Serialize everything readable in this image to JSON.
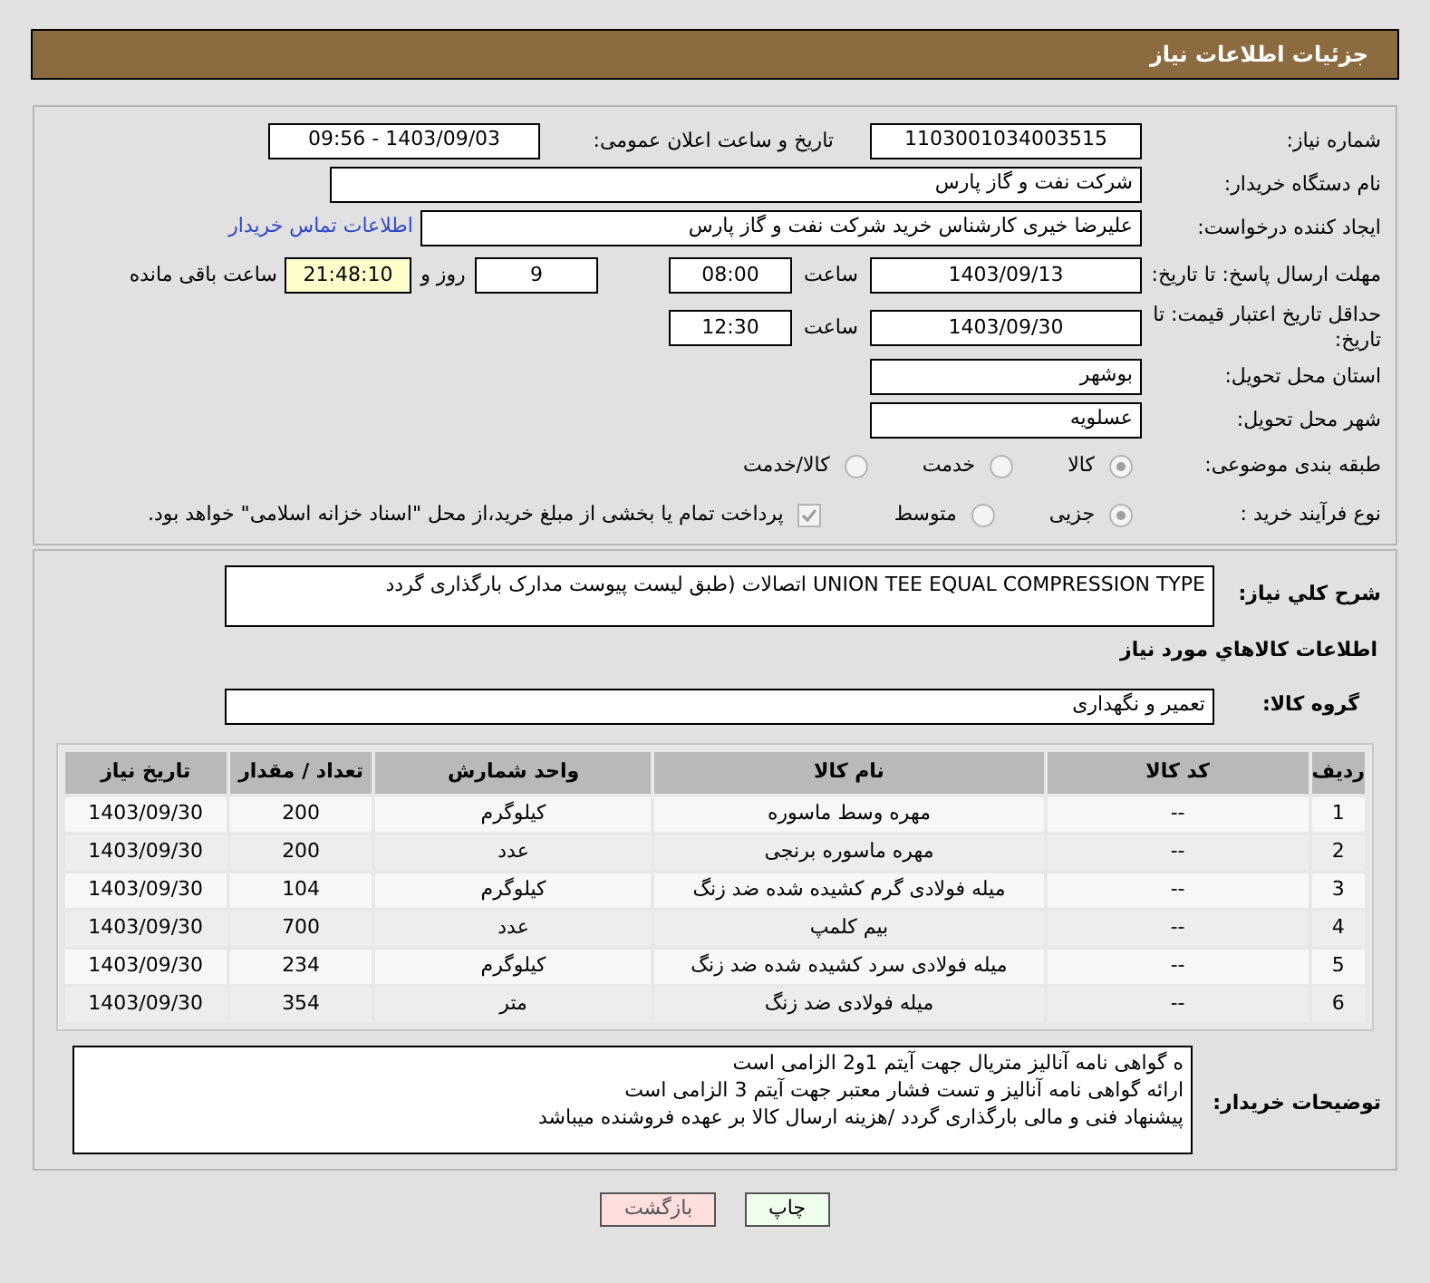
{
  "header": {
    "title": "جزئیات اطلاعات نیاز"
  },
  "need_number": {
    "label": "شماره نیاز:",
    "value": "1103001034003515"
  },
  "announce": {
    "label": "تاریخ و ساعت اعلان عمومی:",
    "value": "1403/09/03 - 09:56"
  },
  "buyer": {
    "label": "نام دستگاه خریدار:",
    "value": "شرکت نفت و گاز پارس"
  },
  "creator": {
    "label": "ایجاد کننده درخواست:",
    "value": "علیرضا  خیری کارشناس خرید  شرکت نفت و گاز پارس",
    "link": "اطلاعات تماس خریدار"
  },
  "deadline": {
    "label": "مهلت ارسال پاسخ: تا تاریخ:",
    "date": "1403/09/13",
    "time_label": "ساعت",
    "time": "08:00",
    "days": "9",
    "days_label": "روز و",
    "remaining": "21:48:10",
    "remaining_label": "ساعت باقی مانده"
  },
  "validity": {
    "label": "حداقل تاریخ اعتبار قیمت: تا تاریخ:",
    "date": "1403/09/30",
    "time_label": "ساعت",
    "time": "12:30"
  },
  "province": {
    "label": "استان محل تحویل:",
    "value": "بوشهر"
  },
  "city": {
    "label": "شهر محل تحویل:",
    "value": "عسلویه"
  },
  "category": {
    "label": "طبقه بندی موضوعی:",
    "options": [
      {
        "label": "کالا",
        "selected": true
      },
      {
        "label": "خدمت",
        "selected": false
      },
      {
        "label": "کالا/خدمت",
        "selected": false
      }
    ]
  },
  "process": {
    "label": "نوع فرآیند خرید :",
    "options": [
      {
        "label": "جزیی",
        "selected": true
      },
      {
        "label": "متوسط",
        "selected": false
      }
    ],
    "treasury": {
      "label": "پرداخت تمام یا بخشی از مبلغ خرید،از محل \"اسناد خزانه اسلامی\" خواهد بود.",
      "checked": true
    }
  },
  "description": {
    "label": "شرح کلي نياز:",
    "value": "UNION TEE EQUAL COMPRESSION TYPE اتصالات (طبق لیست پیوست مدارک بارگذاری گردد"
  },
  "items_heading": "اطلاعات کالاهاي مورد نياز",
  "goods_group": {
    "label": "گروه کالا:",
    "value": "تعمیر و نگهداری"
  },
  "table": {
    "columns": [
      "ردیف",
      "کد کالا",
      "نام کالا",
      "واحد شمارش",
      "تعداد / مقدار",
      "تاریخ نیاز"
    ],
    "rows": [
      [
        "1",
        "--",
        "مهره وسط ماسوره",
        "کیلوگرم",
        "200",
        "1403/09/30"
      ],
      [
        "2",
        "--",
        "مهره ماسوره برنجی",
        "عدد",
        "200",
        "1403/09/30"
      ],
      [
        "3",
        "--",
        "میله فولادی گرم کشیده شده ضد زنگ",
        "کیلوگرم",
        "104",
        "1403/09/30"
      ],
      [
        "4",
        "--",
        "بیم کلمپ",
        "عدد",
        "700",
        "1403/09/30"
      ],
      [
        "5",
        "--",
        "میله فولادی سرد کشیده شده ضد زنگ",
        "کیلوگرم",
        "234",
        "1403/09/30"
      ],
      [
        "6",
        "--",
        "میله فولادی ضد زنگ",
        "متر",
        "354",
        "1403/09/30"
      ]
    ]
  },
  "notes": {
    "label": "توضیحات خریدار:",
    "lines": [
      "ه گواهی نامه آنالیز متریال جهت آیتم 1و2 الزامی است",
      "ارائه گواهی نامه آنالیز و تست فشار معتبر جهت آیتم 3 الزامی است",
      "پیشنهاد فنی و مالی بارگذاری گردد /هزینه ارسال کالا بر عهده فروشنده میباشد"
    ]
  },
  "buttons": [
    {
      "label": "چاپ",
      "kind": "print"
    },
    {
      "label": "بازگشت",
      "kind": "back"
    }
  ]
}
